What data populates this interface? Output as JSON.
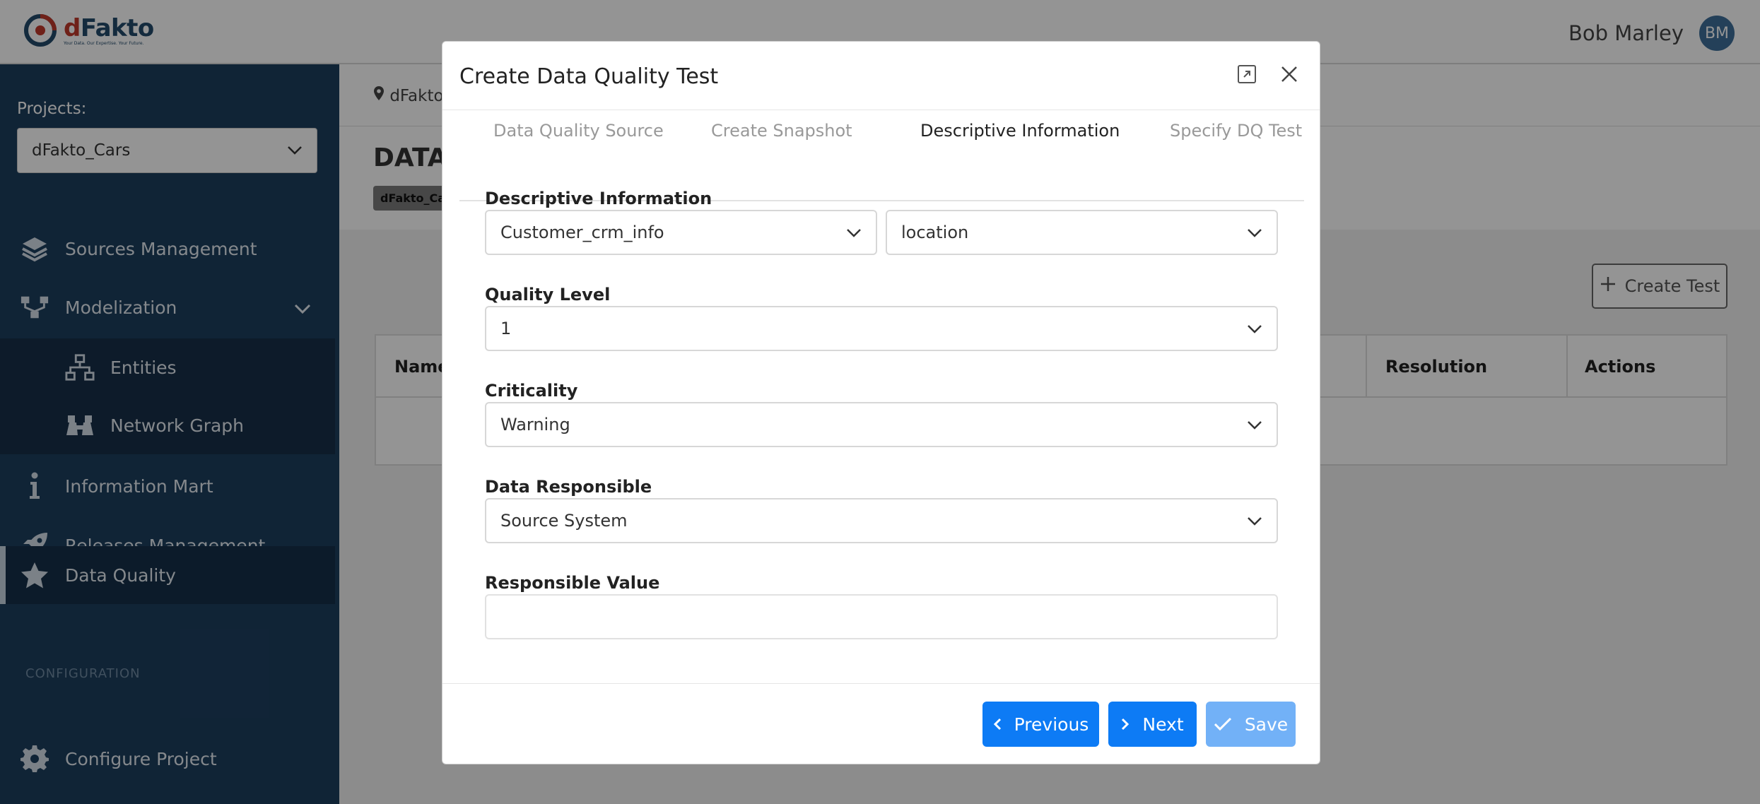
{
  "header": {
    "logo_name_d": "d",
    "logo_name_rest": "Fakto",
    "logo_tagline": "Your Data. Our Expertise. Your Future.",
    "user_name": "Bob Marley",
    "user_initials": "BM"
  },
  "sidebar": {
    "projects_label": "Projects:",
    "project_selected": "dFakto_Cars",
    "items": [
      {
        "label": "Sources Management",
        "icon": "layers-icon"
      },
      {
        "label": "Modelization",
        "icon": "hierarchy-icon"
      },
      {
        "label": "Entities",
        "icon": "sitemap-icon"
      },
      {
        "label": "Network Graph",
        "icon": "binoculars-icon"
      },
      {
        "label": "Information Mart",
        "icon": "info-icon"
      },
      {
        "label": "Releases Management",
        "icon": "rocket-icon"
      },
      {
        "label": "Data Quality",
        "icon": "star-icon"
      },
      {
        "label": "Configure Project",
        "icon": "gear-icon"
      }
    ],
    "config_label": "CONFIGURATION"
  },
  "main": {
    "breadcrumb": "dFakto",
    "page_title": "DATA",
    "project_tag": "dFakto_Car",
    "create_test_label": "Create Test",
    "table_headers": [
      "Name",
      "Resolution",
      "Actions"
    ]
  },
  "modal": {
    "title": "Create Data Quality Test",
    "steps": [
      "Data Quality Source",
      "Create Snapshot",
      "Descriptive Information",
      "Specify DQ Test"
    ],
    "active_step": 2,
    "fields": {
      "descriptive_label": "Descriptive Information",
      "descriptive_table": "Customer_crm_info",
      "descriptive_column": "location",
      "quality_level_label": "Quality Level",
      "quality_level_value": "1",
      "criticality_label": "Criticality",
      "criticality_value": "Warning",
      "data_responsible_label": "Data Responsible",
      "data_responsible_value": "Source System",
      "responsible_value_label": "Responsible Value",
      "responsible_value_value": ""
    },
    "buttons": {
      "previous": "Previous",
      "next": "Next",
      "save": "Save"
    }
  },
  "colors": {
    "sidebar_bg": "#1d3e5e",
    "primary": "#0d7bf5",
    "primary_disabled": "#72b1f7"
  }
}
